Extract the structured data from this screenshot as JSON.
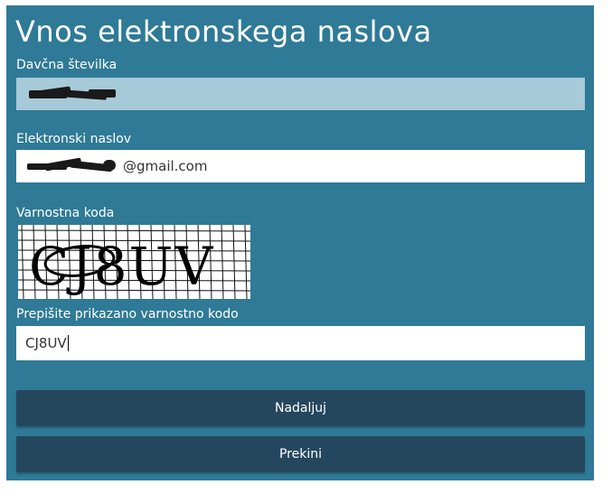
{
  "form": {
    "title": "Vnos elektronskega naslova",
    "tax_number": {
      "label": "Davčna številka"
    },
    "email": {
      "label": "Elektronski naslov",
      "visible_suffix": "@gmail.com"
    },
    "captcha": {
      "label": "Varnostna koda",
      "image_text": "CJ8UV"
    },
    "captcha_input": {
      "label": "Prepišite prikazano varnostno kodo",
      "value": "CJ8UV"
    },
    "buttons": {
      "continue_label": "Nadaljuj",
      "cancel_label": "Prekini"
    }
  },
  "colors": {
    "panel_background": "#2f7a96",
    "readonly_field": "#a7cad8",
    "button_background": "#25475e",
    "text_light": "#ffffff"
  }
}
